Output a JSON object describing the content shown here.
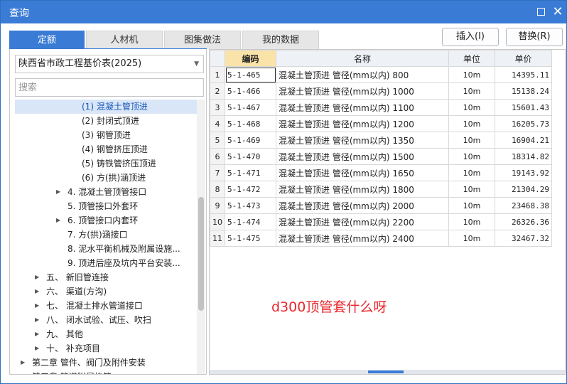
{
  "window": {
    "title": "查询",
    "maximize_icon": "maximize-icon",
    "close_icon": "close-icon",
    "close_glyph": "✕"
  },
  "tabs": [
    {
      "label": "定额",
      "active": true
    },
    {
      "label": "人材机",
      "active": false
    },
    {
      "label": "图集做法",
      "active": false
    },
    {
      "label": "我的数据",
      "active": false
    }
  ],
  "actions": {
    "insert_label": "插入(I)",
    "replace_label": "替换(R)"
  },
  "left": {
    "library": "陕西省市政工程基价表(2025)",
    "search_placeholder": "搜索",
    "tree": [
      {
        "label": "(1) 混凝土管顶进",
        "expander": "",
        "selected": true
      },
      {
        "label": "(2) 封闭式顶进",
        "expander": ""
      },
      {
        "label": "(3) 钢管顶进",
        "expander": ""
      },
      {
        "label": "(4) 钢管挤压顶进",
        "expander": ""
      },
      {
        "label": "(5) 铸铁管挤压顶进",
        "expander": ""
      },
      {
        "label": "(6) 方(拱)涵顶进",
        "expander": ""
      },
      {
        "label": "4. 混凝土管顶管接口",
        "expander": "▶"
      },
      {
        "label": "5. 顶管接口外套环",
        "expander": ""
      },
      {
        "label": "6. 顶管接口内套环",
        "expander": "▶"
      },
      {
        "label": "7. 方(拱)涵接口",
        "expander": ""
      },
      {
        "label": "8. 泥水平衡机械及附属设施...",
        "expander": ""
      },
      {
        "label": "9. 顶进后座及坑内平台安装...",
        "expander": ""
      },
      {
        "label": "五、 新旧管连接",
        "expander": "▶"
      },
      {
        "label": "六、 渠道(方沟)",
        "expander": "▶"
      },
      {
        "label": "七、 混凝土排水管道接口",
        "expander": "▶"
      },
      {
        "label": "八、 闭水试验、试压、吹扫",
        "expander": "▶"
      },
      {
        "label": "九、 其他",
        "expander": "▶"
      },
      {
        "label": "十、 补充项目",
        "expander": "▶"
      },
      {
        "label": "第二章 管件、阀门及附件安装",
        "expander": "▶"
      },
      {
        "label": "第三章 管道附属构筑...",
        "expander": "▶"
      }
    ]
  },
  "table": {
    "headers": {
      "code": "编码",
      "name": "名称",
      "unit": "单位",
      "price": "单价"
    },
    "rows": [
      {
        "n": "1",
        "code": "5-1-465",
        "name": "混凝土管顶进 管径(mm以内) 800",
        "unit": "10m",
        "price": "14395.11"
      },
      {
        "n": "2",
        "code": "5-1-466",
        "name": "混凝土管顶进 管径(mm以内) 1000",
        "unit": "10m",
        "price": "15138.24"
      },
      {
        "n": "3",
        "code": "5-1-467",
        "name": "混凝土管顶进 管径(mm以内) 1100",
        "unit": "10m",
        "price": "15601.43"
      },
      {
        "n": "4",
        "code": "5-1-468",
        "name": "混凝土管顶进 管径(mm以内) 1200",
        "unit": "10m",
        "price": "16205.73"
      },
      {
        "n": "5",
        "code": "5-1-469",
        "name": "混凝土管顶进 管径(mm以内) 1350",
        "unit": "10m",
        "price": "16904.21"
      },
      {
        "n": "6",
        "code": "5-1-470",
        "name": "混凝土管顶进 管径(mm以内) 1500",
        "unit": "10m",
        "price": "18314.82"
      },
      {
        "n": "7",
        "code": "5-1-471",
        "name": "混凝土管顶进 管径(mm以内) 1650",
        "unit": "10m",
        "price": "19143.92"
      },
      {
        "n": "8",
        "code": "5-1-472",
        "name": "混凝土管顶进 管径(mm以内) 1800",
        "unit": "10m",
        "price": "21304.29"
      },
      {
        "n": "9",
        "code": "5-1-473",
        "name": "混凝土管顶进 管径(mm以内) 2000",
        "unit": "10m",
        "price": "23468.38"
      },
      {
        "n": "10",
        "code": "5-1-474",
        "name": "混凝土管顶进 管径(mm以内) 2200",
        "unit": "10m",
        "price": "26326.36"
      },
      {
        "n": "11",
        "code": "5-1-475",
        "name": "混凝土管顶进 管径(mm以内) 2400",
        "unit": "10m",
        "price": "32467.32"
      }
    ]
  },
  "annotation": "d300顶管套什么呀",
  "colors": {
    "accent": "#3a7bd5",
    "annotation": "#e8262c",
    "code_header": "#f9e3a8"
  }
}
